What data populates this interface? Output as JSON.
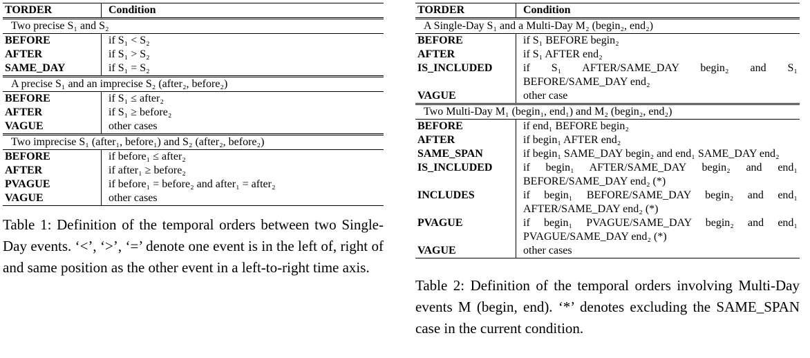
{
  "table1": {
    "headers": [
      "TORDER",
      "Condition"
    ],
    "sections": [
      {
        "title": "Two precise S₁ and S₂",
        "rows": [
          {
            "order": "BEFORE",
            "condition": "if S₁ < S₂"
          },
          {
            "order": "AFTER",
            "condition": "if S₁ > S₂"
          },
          {
            "order": "SAME_DAY",
            "condition": "if S₁ = S₂"
          }
        ]
      },
      {
        "title": "A precise S₁ and an imprecise S₂ (after₂, before₂)",
        "rows": [
          {
            "order": "BEFORE",
            "condition": "if S₁ ≤ after₂"
          },
          {
            "order": "AFTER",
            "condition": "if S₁ ≥ before₂"
          },
          {
            "order": "VAGUE",
            "condition": "other cases"
          }
        ]
      },
      {
        "title": "Two imprecise S₁ (after₁, before₁) and S₂ (after₂, before₂)",
        "rows": [
          {
            "order": "BEFORE",
            "condition": "if before₁ ≤ after₂"
          },
          {
            "order": "AFTER",
            "condition": "if after₁ ≥ before₂"
          },
          {
            "order": "PVAGUE",
            "condition": "if before₁ = before₂ and after₁ = after₂"
          },
          {
            "order": "VAGUE",
            "condition": "other cases"
          }
        ]
      }
    ],
    "caption": "Table 1: Definition of the temporal orders between two Single-Day events. ‘<’, ‘>’, ‘=’ denote one event is in the left of, right of and same position as the other event in a left-to-right time axis."
  },
  "table2": {
    "headers": [
      "TORDER",
      "Condition"
    ],
    "sections": [
      {
        "title": "A Single-Day S₁ and a Multi-Day M₂ (begin₂, end₂)",
        "rows": [
          {
            "order": "BEFORE",
            "condition": "if S₁ BEFORE begin₂"
          },
          {
            "order": "AFTER",
            "condition": "if S₁ AFTER end₂"
          },
          {
            "order": "IS_INCLUDED",
            "condition": "if S₁ AFTER/SAME_DAY begin₂ and S₁ BEFORE/SAME_DAY end₂"
          },
          {
            "order": "VAGUE",
            "condition": "other case"
          }
        ]
      },
      {
        "title": "Two Multi-Day M₁ (begin₁, end₁) and M₂ (begin₂, end₂)",
        "rows": [
          {
            "order": "BEFORE",
            "condition": "if end₁ BEFORE begin₂"
          },
          {
            "order": "AFTER",
            "condition": "if begin₁ AFTER end₂"
          },
          {
            "order": "SAME_SPAN",
            "condition": "if begin₁ SAME_DAY begin₂ and end₁ SAME_DAY end₂"
          },
          {
            "order": "IS_INCLUDED",
            "condition": "if begin₁ AFTER/SAME_DAY begin₂ and end₁ BEFORE/SAME_DAY end₂ (*)"
          },
          {
            "order": "INCLUDES",
            "condition": "if begin₁ BEFORE/SAME_DAY begin₂ and end₁ AFTER/SAME_DAY end₂ (*)"
          },
          {
            "order": "PVAGUE",
            "condition": "if begin₁ PVAGUE/SAME_DAY begin₂ and end₁ PVAGUE/SAME_DAY end₂ (*)"
          },
          {
            "order": "VAGUE",
            "condition": "other cases"
          }
        ]
      }
    ],
    "caption": "Table 2: Definition of the temporal orders involving Multi-Day events M (begin, end). ‘*’ denotes excluding the SAME_SPAN case in the current condition."
  }
}
